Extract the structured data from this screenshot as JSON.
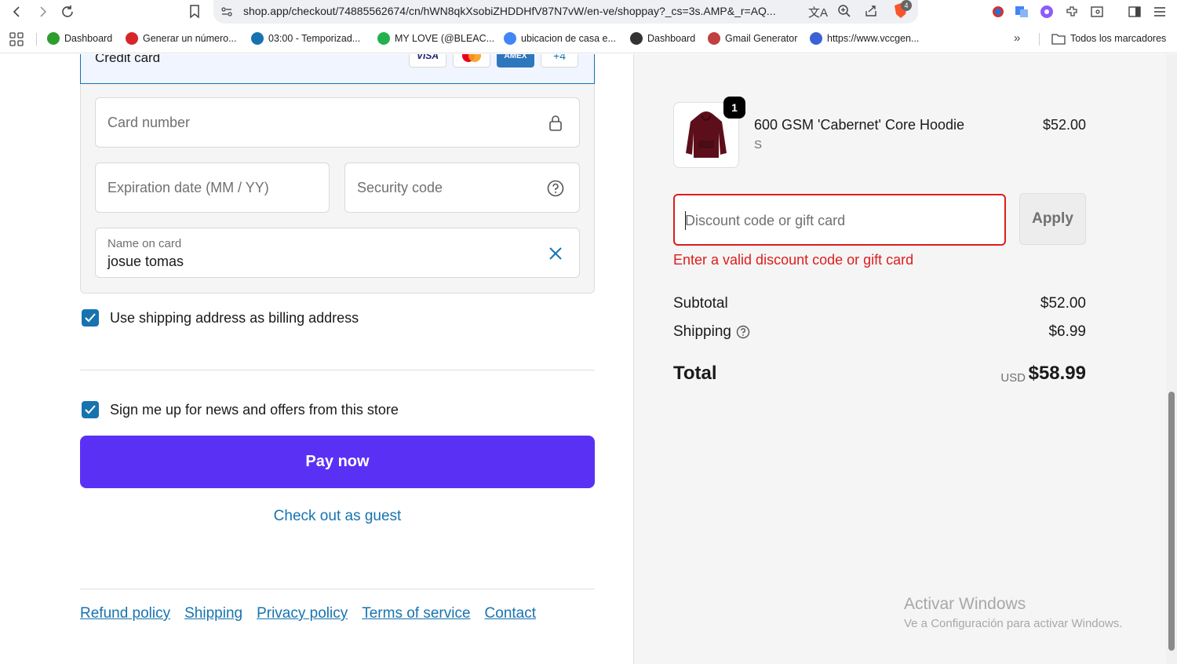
{
  "browser": {
    "url": "shop.app/checkout/74885562674/cn/hWN8qkXsobiZHDDHfV87N7vW/en-ve/shoppay?_cs=3s.AMP&_r=AQ...",
    "brave_badge": "4",
    "bookmarks": [
      {
        "label": "Dashboard",
        "color": "#2e9d2e"
      },
      {
        "label": "Generar un número...",
        "color": "#d6262c"
      },
      {
        "label": "03:00 - Temporizad...",
        "color": "#1773b0"
      },
      {
        "label": "MY LOVE (@BLEAC...",
        "color": "#22b14c"
      },
      {
        "label": "ubicacion de casa e...",
        "color": "#4285f4"
      },
      {
        "label": "Dashboard",
        "color": "#333333"
      },
      {
        "label": "Gmail Generator",
        "color": "#c04040"
      },
      {
        "label": "https://www.vccgen...",
        "color": "#3b62d4"
      }
    ],
    "all_bookmarks": "Todos los marcadores"
  },
  "payment": {
    "method_title": "Credit card",
    "card_logos": [
      "VISA",
      "",
      "AMEX",
      "+4"
    ],
    "card_number_placeholder": "Card number",
    "expiration_placeholder": "Expiration date (MM / YY)",
    "security_placeholder": "Security code",
    "name_label": "Name on card",
    "name_value": "josue tomas"
  },
  "options": {
    "billing_same": "Use shipping address as billing address",
    "newsletter": "Sign me up for news and offers from this store"
  },
  "actions": {
    "pay_now": "Pay now",
    "guest": "Check out as guest"
  },
  "footer": {
    "links": [
      "Refund policy",
      "Shipping",
      "Privacy policy",
      "Terms of service",
      "Contact"
    ]
  },
  "summary": {
    "product_name": "600 GSM 'Cabernet' Core Hoodie",
    "variant": "S",
    "quantity": "1",
    "price": "$52.00",
    "discount_placeholder": "Discount code or gift card",
    "apply": "Apply",
    "error": "Enter a valid discount code or gift card",
    "subtotal_label": "Subtotal",
    "subtotal": "$52.00",
    "shipping_label": "Shipping",
    "shipping": "$6.99",
    "total_label": "Total",
    "currency": "USD",
    "total": "$58.99"
  },
  "watermark": {
    "line1": "Activar Windows",
    "line2": "Ve a Configuración para activar Windows."
  },
  "colors": {
    "accent": "#1773b0",
    "pay_button": "#5a31f4",
    "error": "#dd1d1d",
    "hoodie": "#5c0f1a"
  }
}
